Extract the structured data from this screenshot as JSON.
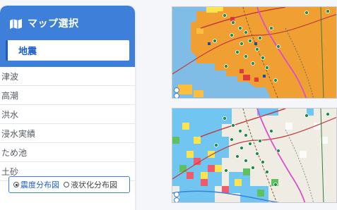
{
  "panel": {
    "title": "マップ選択",
    "selected": "地震",
    "items": [
      "津波",
      "高潮",
      "洪水",
      "浸水実績",
      "ため池",
      "土砂"
    ]
  },
  "radio": {
    "options": [
      {
        "label": "震度分布図",
        "checked": true
      },
      {
        "label": "液状化分布図",
        "checked": false
      }
    ]
  },
  "colors": {
    "accent": "#3d7fd9",
    "intensity_orange": "#f0a032",
    "sea": "#7fbde6",
    "liquefaction_blue": "#70c6f0"
  },
  "maps": [
    {
      "name": "seismic-intensity-map"
    },
    {
      "name": "liquefaction-map"
    }
  ]
}
